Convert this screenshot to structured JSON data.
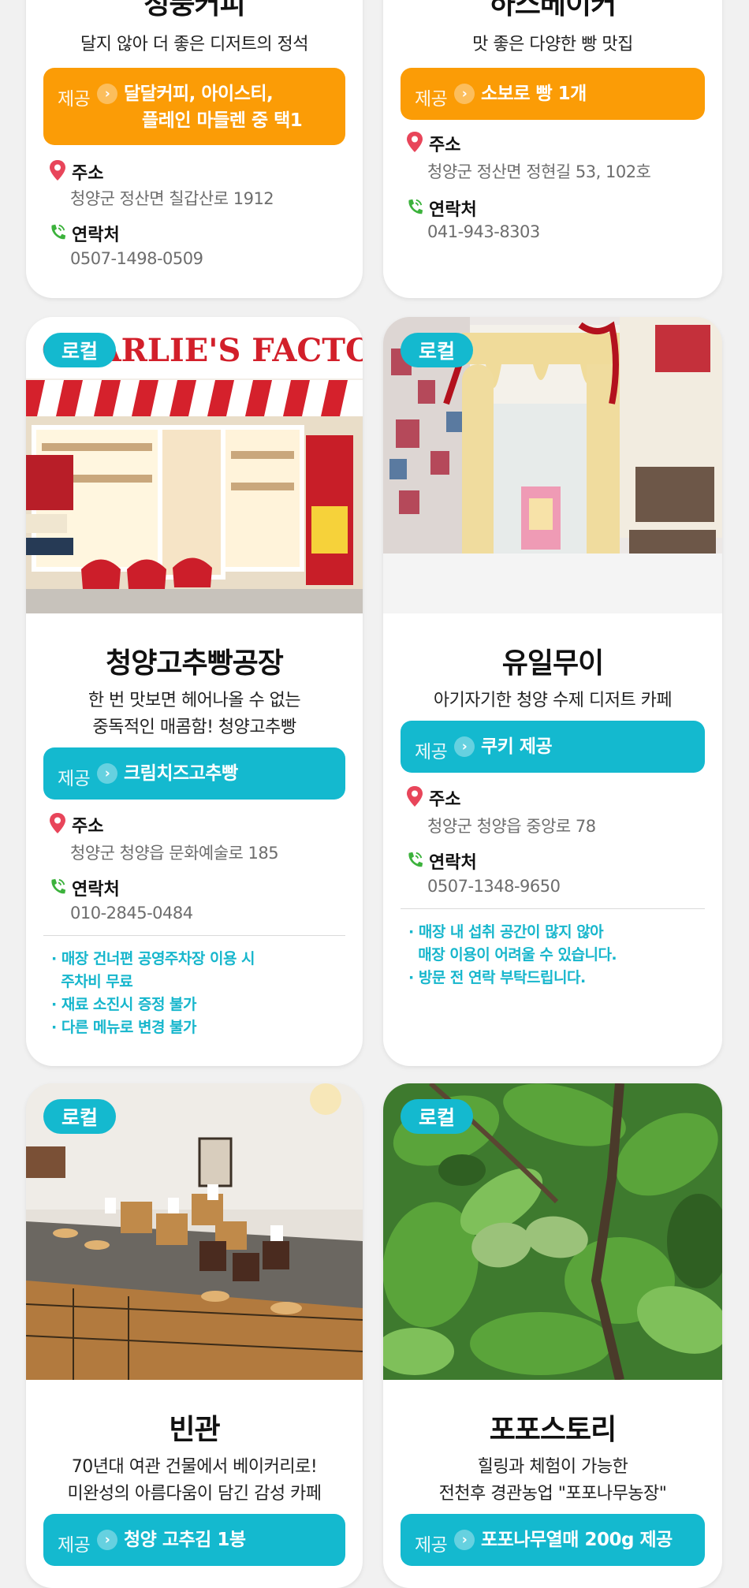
{
  "cards": [
    {
      "title": "청풍커피",
      "subtitle": "달지 않아 더 좋은 디저트의 정석",
      "offer_tag": "제공",
      "offer_line1": "달달커피, 아이스티,",
      "offer_line2": "플레인 마들렌 중 택1",
      "address_label": "주소",
      "address": "청양군 정산면 칠갑산로 1912",
      "contact_label": "연락처",
      "phone": "0507-1498-0509"
    },
    {
      "title": "하스베이커",
      "subtitle": "맛 좋은 다양한 빵 맛집",
      "offer_tag": "제공",
      "offer_line1": "소보로 빵 1개",
      "address_label": "주소",
      "address": "청양군 정산면 정현길 53, 102호",
      "contact_label": "연락처",
      "phone": "041-943-8303"
    },
    {
      "badge": "로컬",
      "photo_text": "CHARLIE'S FACTORY",
      "title": "청양고추빵공장",
      "subtitle_line1": "한 번 맛보면 헤어나올 수 없는",
      "subtitle_line2": "중독적인 매콤함! 청양고추빵",
      "offer_tag": "제공",
      "offer_line1": "크림치즈고추빵",
      "address_label": "주소",
      "address": "청양군 청양읍 문화예술로 185",
      "contact_label": "연락처",
      "phone": "010-2845-0484",
      "notes": [
        "· 매장 건너편 공영주차장 이용 시",
        "  주차비 무료",
        "· 재료 소진시 증정 불가",
        "· 다른 메뉴로 변경 불가"
      ]
    },
    {
      "badge": "로컬",
      "title": "유일무이",
      "subtitle": "아기자기한 청양 수제 디저트 카페",
      "offer_tag": "제공",
      "offer_line1": "쿠키 제공",
      "address_label": "주소",
      "address": "청양군 청양읍 중앙로 78",
      "contact_label": "연락처",
      "phone": "0507-1348-9650",
      "notes": [
        "· 매장 내 섭취 공간이 많지 않아",
        "  매장 이용이 어려울 수 있습니다.",
        "· 방문 전 연락 부탁드립니다."
      ]
    },
    {
      "badge": "로컬",
      "title": "빈관",
      "subtitle_line1": "70년대 여관 건물에서 베이커리로!",
      "subtitle_line2": "미완성의 아름다움이 담긴 감성 카페",
      "offer_tag": "제공",
      "offer_line1": "청양 고추김 1봉"
    },
    {
      "badge": "로컬",
      "title": "포포스토리",
      "subtitle_line1": "힐링과 체험이 가능한",
      "subtitle_line2": "전천후 경관농업 \"포포나무농장\"",
      "offer_tag": "제공",
      "offer_line1": "포포나무열매 200g 제공"
    }
  ],
  "colors": {
    "accent_teal": "#14b9cf",
    "accent_orange": "#fb9c06",
    "pin_red": "#e8455a",
    "phone_green": "#3cb23c"
  }
}
